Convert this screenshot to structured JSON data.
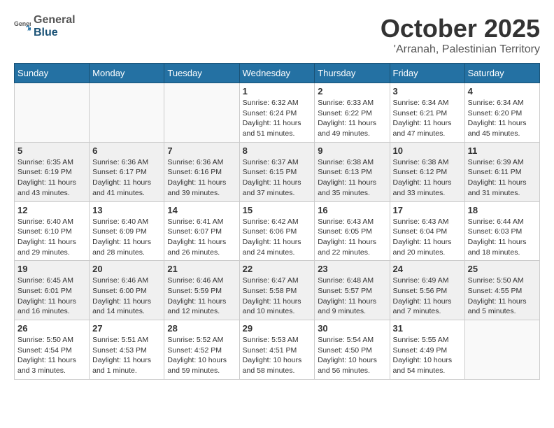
{
  "logo": {
    "general": "General",
    "blue": "Blue"
  },
  "title": {
    "month": "October 2025",
    "location": "'Arranah, Palestinian Territory"
  },
  "weekdays": [
    "Sunday",
    "Monday",
    "Tuesday",
    "Wednesday",
    "Thursday",
    "Friday",
    "Saturday"
  ],
  "weeks": [
    [
      {
        "day": "",
        "sunrise": "",
        "sunset": "",
        "daylight": ""
      },
      {
        "day": "",
        "sunrise": "",
        "sunset": "",
        "daylight": ""
      },
      {
        "day": "",
        "sunrise": "",
        "sunset": "",
        "daylight": ""
      },
      {
        "day": "1",
        "sunrise": "Sunrise: 6:32 AM",
        "sunset": "Sunset: 6:24 PM",
        "daylight": "Daylight: 11 hours and 51 minutes."
      },
      {
        "day": "2",
        "sunrise": "Sunrise: 6:33 AM",
        "sunset": "Sunset: 6:22 PM",
        "daylight": "Daylight: 11 hours and 49 minutes."
      },
      {
        "day": "3",
        "sunrise": "Sunrise: 6:34 AM",
        "sunset": "Sunset: 6:21 PM",
        "daylight": "Daylight: 11 hours and 47 minutes."
      },
      {
        "day": "4",
        "sunrise": "Sunrise: 6:34 AM",
        "sunset": "Sunset: 6:20 PM",
        "daylight": "Daylight: 11 hours and 45 minutes."
      }
    ],
    [
      {
        "day": "5",
        "sunrise": "Sunrise: 6:35 AM",
        "sunset": "Sunset: 6:19 PM",
        "daylight": "Daylight: 11 hours and 43 minutes."
      },
      {
        "day": "6",
        "sunrise": "Sunrise: 6:36 AM",
        "sunset": "Sunset: 6:17 PM",
        "daylight": "Daylight: 11 hours and 41 minutes."
      },
      {
        "day": "7",
        "sunrise": "Sunrise: 6:36 AM",
        "sunset": "Sunset: 6:16 PM",
        "daylight": "Daylight: 11 hours and 39 minutes."
      },
      {
        "day": "8",
        "sunrise": "Sunrise: 6:37 AM",
        "sunset": "Sunset: 6:15 PM",
        "daylight": "Daylight: 11 hours and 37 minutes."
      },
      {
        "day": "9",
        "sunrise": "Sunrise: 6:38 AM",
        "sunset": "Sunset: 6:13 PM",
        "daylight": "Daylight: 11 hours and 35 minutes."
      },
      {
        "day": "10",
        "sunrise": "Sunrise: 6:38 AM",
        "sunset": "Sunset: 6:12 PM",
        "daylight": "Daylight: 11 hours and 33 minutes."
      },
      {
        "day": "11",
        "sunrise": "Sunrise: 6:39 AM",
        "sunset": "Sunset: 6:11 PM",
        "daylight": "Daylight: 11 hours and 31 minutes."
      }
    ],
    [
      {
        "day": "12",
        "sunrise": "Sunrise: 6:40 AM",
        "sunset": "Sunset: 6:10 PM",
        "daylight": "Daylight: 11 hours and 29 minutes."
      },
      {
        "day": "13",
        "sunrise": "Sunrise: 6:40 AM",
        "sunset": "Sunset: 6:09 PM",
        "daylight": "Daylight: 11 hours and 28 minutes."
      },
      {
        "day": "14",
        "sunrise": "Sunrise: 6:41 AM",
        "sunset": "Sunset: 6:07 PM",
        "daylight": "Daylight: 11 hours and 26 minutes."
      },
      {
        "day": "15",
        "sunrise": "Sunrise: 6:42 AM",
        "sunset": "Sunset: 6:06 PM",
        "daylight": "Daylight: 11 hours and 24 minutes."
      },
      {
        "day": "16",
        "sunrise": "Sunrise: 6:43 AM",
        "sunset": "Sunset: 6:05 PM",
        "daylight": "Daylight: 11 hours and 22 minutes."
      },
      {
        "day": "17",
        "sunrise": "Sunrise: 6:43 AM",
        "sunset": "Sunset: 6:04 PM",
        "daylight": "Daylight: 11 hours and 20 minutes."
      },
      {
        "day": "18",
        "sunrise": "Sunrise: 6:44 AM",
        "sunset": "Sunset: 6:03 PM",
        "daylight": "Daylight: 11 hours and 18 minutes."
      }
    ],
    [
      {
        "day": "19",
        "sunrise": "Sunrise: 6:45 AM",
        "sunset": "Sunset: 6:01 PM",
        "daylight": "Daylight: 11 hours and 16 minutes."
      },
      {
        "day": "20",
        "sunrise": "Sunrise: 6:46 AM",
        "sunset": "Sunset: 6:00 PM",
        "daylight": "Daylight: 11 hours and 14 minutes."
      },
      {
        "day": "21",
        "sunrise": "Sunrise: 6:46 AM",
        "sunset": "Sunset: 5:59 PM",
        "daylight": "Daylight: 11 hours and 12 minutes."
      },
      {
        "day": "22",
        "sunrise": "Sunrise: 6:47 AM",
        "sunset": "Sunset: 5:58 PM",
        "daylight": "Daylight: 11 hours and 10 minutes."
      },
      {
        "day": "23",
        "sunrise": "Sunrise: 6:48 AM",
        "sunset": "Sunset: 5:57 PM",
        "daylight": "Daylight: 11 hours and 9 minutes."
      },
      {
        "day": "24",
        "sunrise": "Sunrise: 6:49 AM",
        "sunset": "Sunset: 5:56 PM",
        "daylight": "Daylight: 11 hours and 7 minutes."
      },
      {
        "day": "25",
        "sunrise": "Sunrise: 5:50 AM",
        "sunset": "Sunset: 4:55 PM",
        "daylight": "Daylight: 11 hours and 5 minutes."
      }
    ],
    [
      {
        "day": "26",
        "sunrise": "Sunrise: 5:50 AM",
        "sunset": "Sunset: 4:54 PM",
        "daylight": "Daylight: 11 hours and 3 minutes."
      },
      {
        "day": "27",
        "sunrise": "Sunrise: 5:51 AM",
        "sunset": "Sunset: 4:53 PM",
        "daylight": "Daylight: 11 hours and 1 minute."
      },
      {
        "day": "28",
        "sunrise": "Sunrise: 5:52 AM",
        "sunset": "Sunset: 4:52 PM",
        "daylight": "Daylight: 10 hours and 59 minutes."
      },
      {
        "day": "29",
        "sunrise": "Sunrise: 5:53 AM",
        "sunset": "Sunset: 4:51 PM",
        "daylight": "Daylight: 10 hours and 58 minutes."
      },
      {
        "day": "30",
        "sunrise": "Sunrise: 5:54 AM",
        "sunset": "Sunset: 4:50 PM",
        "daylight": "Daylight: 10 hours and 56 minutes."
      },
      {
        "day": "31",
        "sunrise": "Sunrise: 5:55 AM",
        "sunset": "Sunset: 4:49 PM",
        "daylight": "Daylight: 10 hours and 54 minutes."
      },
      {
        "day": "",
        "sunrise": "",
        "sunset": "",
        "daylight": ""
      }
    ]
  ]
}
